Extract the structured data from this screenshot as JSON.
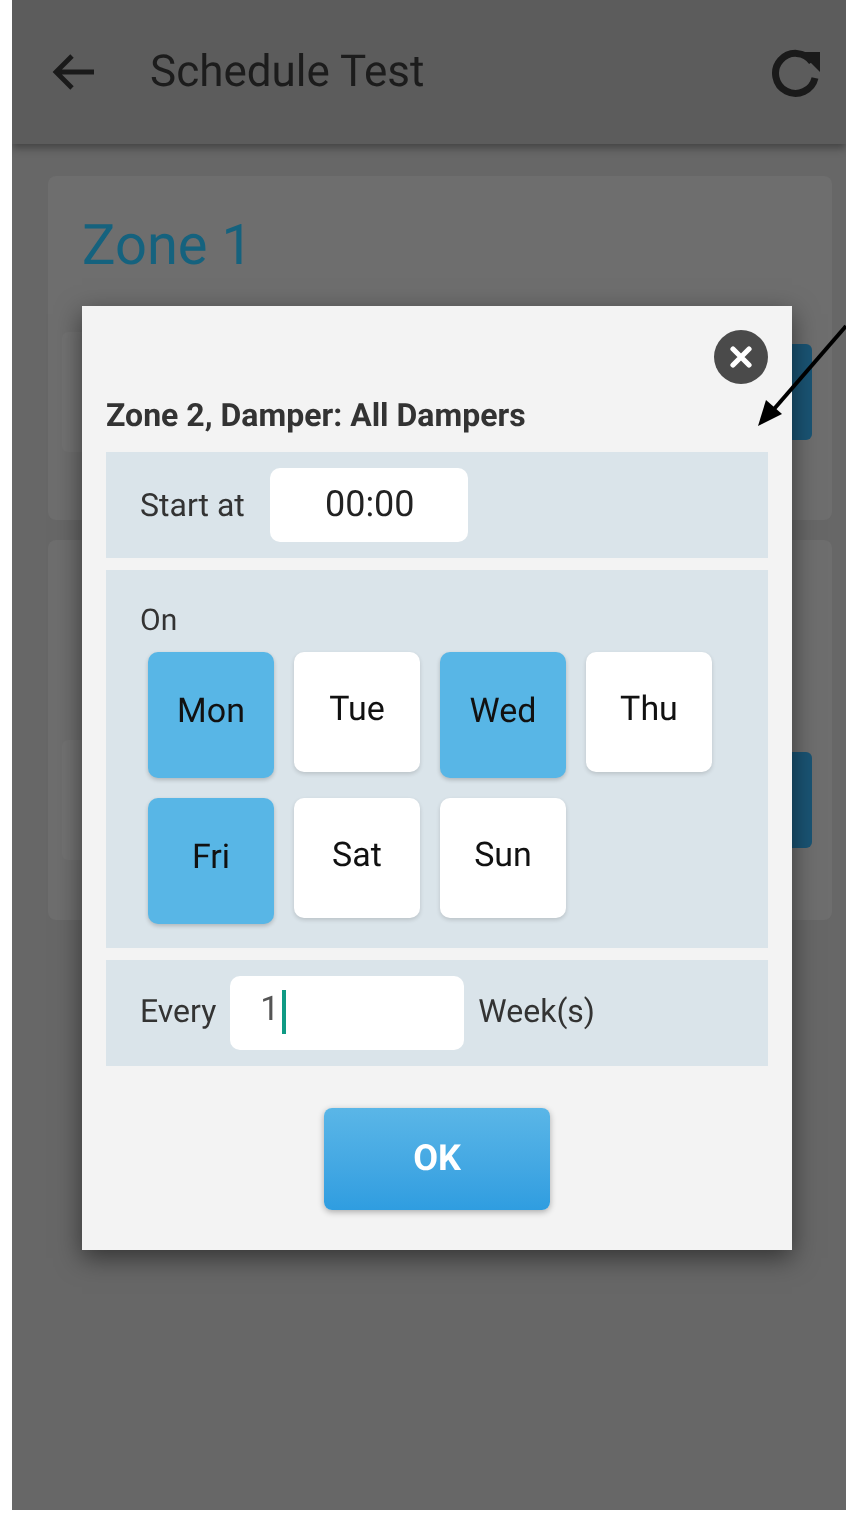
{
  "app_bar": {
    "title": "Schedule Test"
  },
  "zone_card": {
    "title": "Zone 1"
  },
  "dialog": {
    "title": "Zone 2, Damper: All Dampers",
    "start": {
      "label": "Start at",
      "value": "00:00"
    },
    "on_label": "On",
    "days": [
      {
        "label": "Mon",
        "selected": true
      },
      {
        "label": "Tue",
        "selected": false
      },
      {
        "label": "Wed",
        "selected": true
      },
      {
        "label": "Thu",
        "selected": false
      },
      {
        "label": "Fri",
        "selected": true
      },
      {
        "label": "Sat",
        "selected": false
      },
      {
        "label": "Sun",
        "selected": false
      }
    ],
    "every": {
      "label": "Every",
      "value": "1",
      "unit": "Week(s)"
    },
    "ok_button": "OK"
  }
}
